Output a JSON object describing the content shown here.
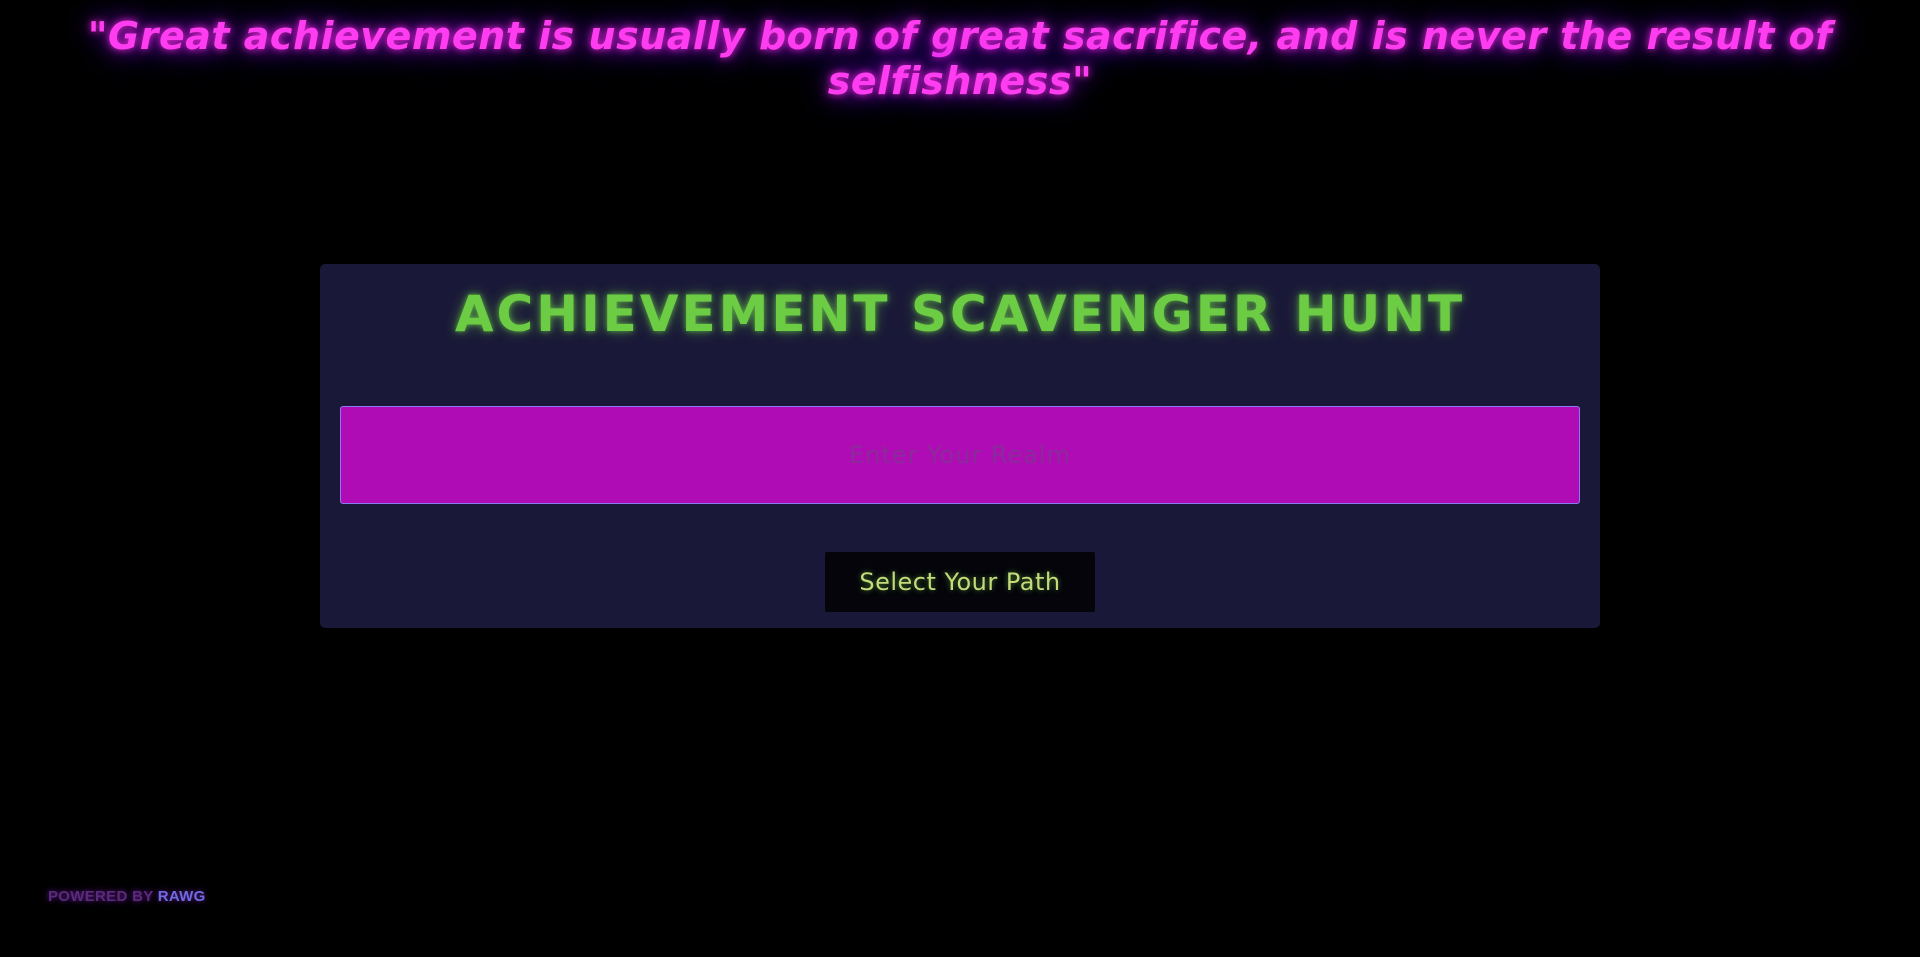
{
  "quote": {
    "text": "\"Great achievement is usually born of great sacrifice, and is never the result of selfishness\""
  },
  "card": {
    "title": "ACHIEVEMENT SCAVENGER HUNT",
    "realm_input": {
      "placeholder": "Enter Your Realm",
      "value": ""
    },
    "path_button_label": "Select Your Path"
  },
  "footer": {
    "powered_by_label": "POWERED BY",
    "brand_label": "RAWG"
  },
  "colors": {
    "background": "#000000",
    "quote": "#ff3df0",
    "card_background": "#1a1838",
    "title": "#6ccd45",
    "input_background": "#b00cb6",
    "button_background": "#04040a",
    "button_text": "#c7d97a",
    "brand": "#6b6ce0"
  }
}
